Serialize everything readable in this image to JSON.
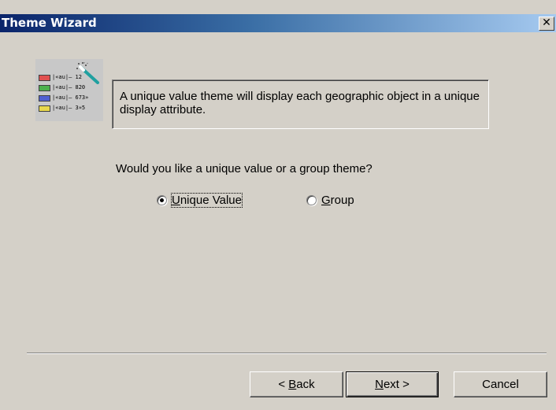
{
  "window": {
    "title": "Theme Wizard",
    "close_glyph": "✕"
  },
  "illustration": {
    "icon": "legend-with-magic-wand-icon",
    "legend_rows": [
      {
        "text": "|«au|— 12",
        "color": "#e05050"
      },
      {
        "text": "|«au|— 820",
        "color": "#4cb04c"
      },
      {
        "text": "|«au|— 673»",
        "color": "#5060d0"
      },
      {
        "text": "|«au|— 3»5",
        "color": "#e8d84c"
      }
    ]
  },
  "info": {
    "text": "A unique value theme will display each geographic object in a unique display attribute."
  },
  "question": "Would you like a unique value or a group theme?",
  "options": {
    "unique": {
      "mnemonic": "U",
      "rest": "nique Value",
      "checked": true
    },
    "group": {
      "mnemonic": "G",
      "rest": "roup",
      "checked": false
    }
  },
  "buttons": {
    "back": {
      "prefix": "< ",
      "mnemonic": "B",
      "rest": "ack"
    },
    "next": {
      "mnemonic": "N",
      "rest": "ext >"
    },
    "cancel": {
      "label": "Cancel"
    }
  }
}
